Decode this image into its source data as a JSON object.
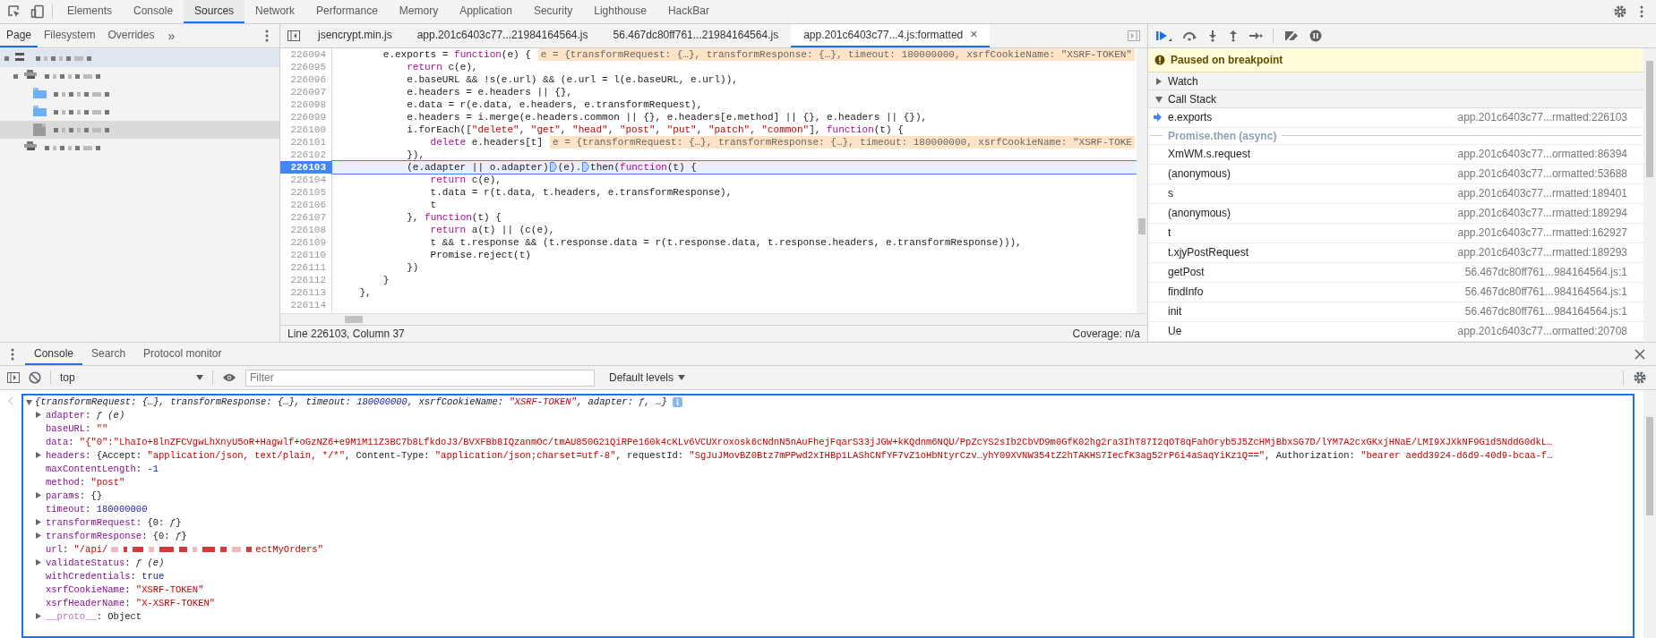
{
  "main_tabs": [
    {
      "label": "Elements",
      "selected": false
    },
    {
      "label": "Console",
      "selected": false
    },
    {
      "label": "Sources",
      "selected": true
    },
    {
      "label": "Network",
      "selected": false
    },
    {
      "label": "Performance",
      "selected": false
    },
    {
      "label": "Memory",
      "selected": false
    },
    {
      "label": "Application",
      "selected": false
    },
    {
      "label": "Security",
      "selected": false
    },
    {
      "label": "Lighthouse",
      "selected": false
    },
    {
      "label": "HackBar",
      "selected": false
    }
  ],
  "navigator": {
    "tabs": [
      {
        "label": "Page",
        "selected": true
      },
      {
        "label": "Filesystem",
        "selected": false
      },
      {
        "label": "Overrides",
        "selected": false
      }
    ],
    "more": "»",
    "tree": [
      {
        "kind": "frame",
        "hovered": true,
        "selected": false,
        "children": [
          {
            "kind": "cloud",
            "hovered": false,
            "selected": false,
            "children": [
              {
                "kind": "folder",
                "hovered": false,
                "selected": false
              },
              {
                "kind": "folder",
                "hovered": false,
                "selected": false
              },
              {
                "kind": "file",
                "hovered": false,
                "selected": true
              }
            ]
          },
          {
            "kind": "cloud",
            "hovered": false,
            "selected": false
          }
        ]
      }
    ]
  },
  "editor": {
    "tabs": [
      {
        "label": "jsencrypt.min.js",
        "selected": false
      },
      {
        "label": "app.201c6403c77...21984164564.js",
        "selected": false
      },
      {
        "label": "56.467dc80ff761...21984164564.js",
        "selected": false
      },
      {
        "label": "app.201c6403c77...4.js:formatted",
        "selected": true
      }
    ],
    "close": "×",
    "lines": [
      {
        "number": "226094",
        "current": false,
        "tokens": [
          {
            "kind": "plain",
            "text": "        e.exports = "
          },
          {
            "kind": "keyword",
            "text": "function"
          },
          {
            "kind": "plain",
            "text": "(e) {"
          },
          {
            "kind": "inline",
            "text": "e = {transformRequest: {…}, transformResponse: {…}, timeout: 180000000, xsrfCookieName: \"XSRF-TOKEN\""
          }
        ]
      },
      {
        "number": "226095",
        "current": false,
        "tokens": [
          {
            "kind": "keyword",
            "text": "            return"
          },
          {
            "kind": "plain",
            "text": " c(e),"
          }
        ]
      },
      {
        "number": "226096",
        "current": false,
        "tokens": [
          {
            "kind": "plain",
            "text": "            e.baseURL && !s(e.url) && (e.url = l(e.baseURL, e.url)),"
          }
        ]
      },
      {
        "number": "226097",
        "current": false,
        "tokens": [
          {
            "kind": "plain",
            "text": "            e.headers = e.headers || {},"
          }
        ]
      },
      {
        "number": "226098",
        "current": false,
        "tokens": [
          {
            "kind": "plain",
            "text": "            e.data = r(e.data, e.headers, e.transformRequest),"
          }
        ]
      },
      {
        "number": "226099",
        "current": false,
        "tokens": [
          {
            "kind": "plain",
            "text": "            e.headers = i.merge(e.headers.common || {}, e.headers[e.method] || {}, e.headers || {}),"
          }
        ]
      },
      {
        "number": "226100",
        "current": false,
        "tokens": [
          {
            "kind": "plain",
            "text": "            i.forEach(["
          },
          {
            "kind": "string",
            "text": "\"delete\""
          },
          {
            "kind": "plain",
            "text": ", "
          },
          {
            "kind": "string",
            "text": "\"get\""
          },
          {
            "kind": "plain",
            "text": ", "
          },
          {
            "kind": "string",
            "text": "\"head\""
          },
          {
            "kind": "plain",
            "text": ", "
          },
          {
            "kind": "string",
            "text": "\"post\""
          },
          {
            "kind": "plain",
            "text": ", "
          },
          {
            "kind": "string",
            "text": "\"put\""
          },
          {
            "kind": "plain",
            "text": ", "
          },
          {
            "kind": "string",
            "text": "\"patch\""
          },
          {
            "kind": "plain",
            "text": ", "
          },
          {
            "kind": "string",
            "text": "\"common\""
          },
          {
            "kind": "plain",
            "text": "], "
          },
          {
            "kind": "keyword",
            "text": "function"
          },
          {
            "kind": "plain",
            "text": "(t) {"
          }
        ]
      },
      {
        "number": "226101",
        "current": false,
        "tokens": [
          {
            "kind": "keyword",
            "text": "                delete"
          },
          {
            "kind": "plain",
            "text": " e.headers[t]"
          },
          {
            "kind": "inline",
            "text": "e = {transformRequest: {…}, transformResponse: {…}, timeout: 180000000, xsrfCookieName: \"XSRF-TOKE"
          }
        ]
      },
      {
        "number": "226102",
        "current": false,
        "tokens": [
          {
            "kind": "plain",
            "text": "            }),"
          }
        ]
      },
      {
        "number": "226103",
        "current": true,
        "tokens": [
          {
            "kind": "plain",
            "text": "            (e.adapter || o.adapter)"
          },
          {
            "kind": "breakpoint"
          },
          {
            "kind": "plain",
            "text": "(e)."
          },
          {
            "kind": "breakpoint"
          },
          {
            "kind": "plain",
            "text": "then("
          },
          {
            "kind": "keyword",
            "text": "function"
          },
          {
            "kind": "plain",
            "text": "(t) {"
          }
        ]
      },
      {
        "number": "226104",
        "current": false,
        "tokens": [
          {
            "kind": "keyword",
            "text": "                return"
          },
          {
            "kind": "plain",
            "text": " c(e),"
          }
        ]
      },
      {
        "number": "226105",
        "current": false,
        "tokens": [
          {
            "kind": "plain",
            "text": "                t.data = r(t.data, t.headers, e.transformResponse),"
          }
        ]
      },
      {
        "number": "226106",
        "current": false,
        "tokens": [
          {
            "kind": "plain",
            "text": "                t"
          }
        ]
      },
      {
        "number": "226107",
        "current": false,
        "tokens": [
          {
            "kind": "plain",
            "text": "            }, "
          },
          {
            "kind": "keyword",
            "text": "function"
          },
          {
            "kind": "plain",
            "text": "(t) {"
          }
        ]
      },
      {
        "number": "226108",
        "current": false,
        "tokens": [
          {
            "kind": "keyword",
            "text": "                return"
          },
          {
            "kind": "plain",
            "text": " a(t) || (c(e),"
          }
        ]
      },
      {
        "number": "226109",
        "current": false,
        "tokens": [
          {
            "kind": "plain",
            "text": "                t && t.response && (t.response.data = r(t.response.data, t.response.headers, e.transformResponse))),"
          }
        ]
      },
      {
        "number": "226110",
        "current": false,
        "tokens": [
          {
            "kind": "plain",
            "text": "                Promise.reject(t)"
          }
        ]
      },
      {
        "number": "226111",
        "current": false,
        "tokens": [
          {
            "kind": "plain",
            "text": "            })"
          }
        ]
      },
      {
        "number": "226112",
        "current": false,
        "tokens": [
          {
            "kind": "plain",
            "text": "        }"
          }
        ]
      },
      {
        "number": "226113",
        "current": false,
        "tokens": [
          {
            "kind": "plain",
            "text": "    },"
          }
        ]
      },
      {
        "number": "226114",
        "current": false
      }
    ],
    "status": "Line 226103, Column 37",
    "coverage": "Coverage: n/a"
  },
  "debugger": {
    "banner": "Paused on breakpoint",
    "sections": [
      {
        "title": "Watch",
        "expanded": false
      },
      {
        "title": "Call Stack",
        "expanded": true
      }
    ],
    "call_stack": [
      {
        "kind": "frame",
        "name": "e.exports",
        "location": "app.201c6403c77...rmatted:226103",
        "current": true
      },
      {
        "kind": "async",
        "name": "Promise.then (async)"
      },
      {
        "kind": "frame",
        "name": "XmWM.s.request",
        "location": "app.201c6403c77...ormatted:86394",
        "current": false
      },
      {
        "kind": "frame",
        "name": "(anonymous)",
        "location": "app.201c6403c77...ormatted:53688",
        "current": false
      },
      {
        "kind": "frame",
        "name": "s",
        "location": "app.201c6403c77...rmatted:189401",
        "current": false
      },
      {
        "kind": "frame",
        "name": "(anonymous)",
        "location": "app.201c6403c77...rmatted:189294",
        "current": false
      },
      {
        "kind": "frame",
        "name": "t",
        "location": "app.201c6403c77...rmatted:162927",
        "current": false
      },
      {
        "kind": "frame",
        "name": "t.xjyPostRequest",
        "location": "app.201c6403c77...rmatted:189293",
        "current": false
      },
      {
        "kind": "frame",
        "name": "getPost",
        "location": "56.467dc80ff761...984164564.js:1",
        "current": false
      },
      {
        "kind": "frame",
        "name": "findInfo",
        "location": "56.467dc80ff761...984164564.js:1",
        "current": false
      },
      {
        "kind": "frame",
        "name": "init",
        "location": "56.467dc80ff761...984164564.js:1",
        "current": false
      },
      {
        "kind": "frame",
        "name": "Ue",
        "location": "app.201c6403c77...ormatted:20708",
        "current": false
      }
    ]
  },
  "drawer": {
    "tabs": [
      {
        "label": "Console",
        "selected": true
      },
      {
        "label": "Search",
        "selected": false
      },
      {
        "label": "Protocol monitor",
        "selected": false
      }
    ],
    "context": "top",
    "filter": {
      "placeholder": "Filter"
    },
    "levels": "Default levels",
    "summary": [
      {
        "kind": "plain",
        "text": "{transformRequest: {…}, transformResponse: {…}, timeout: "
      },
      {
        "kind": "number",
        "text": "180000000"
      },
      {
        "kind": "plain",
        "text": ", xsrfCookieName: "
      },
      {
        "kind": "string",
        "text": "\"XSRF-TOKEN\""
      },
      {
        "kind": "plain",
        "text": ", adapter: ƒ, …}"
      }
    ],
    "properties": [
      {
        "expandable": true,
        "segments": [
          {
            "kind": "key",
            "text": "adapter"
          },
          {
            "kind": "plain",
            "text": ": "
          },
          {
            "kind": "function",
            "text": "ƒ (e)"
          }
        ]
      },
      {
        "expandable": false,
        "segments": [
          {
            "kind": "key",
            "text": "baseURL"
          },
          {
            "kind": "plain",
            "text": ": "
          },
          {
            "kind": "string",
            "text": "\"\""
          }
        ]
      },
      {
        "expandable": false,
        "segments": [
          {
            "kind": "key",
            "text": "data"
          },
          {
            "kind": "plain",
            "text": ": "
          },
          {
            "kind": "string",
            "text": "\"{\"0\":\"LhaIo+8lnZFCVgwLhXnyU5oR+Hagwlf+oGzNZ6+e9M1M11Z3BC7b8LfkdoJ3/BVXFBb8IQzanmOc/tmAU850G21QiRPe160k4cKLv6VCUXroxosk6cNdnN5nAuFhejFqarS33jJGW+kKQdnm6NQU/PpZcYS2sIb2CbVD9m0GfK02hg2ra3IhT87I2qOT8qFahOryb5J5ZcHMjBbxSG7D/lYM7A2cxGKxjHNaE/LMI9XJXkNF9G1d5NddG0dkL…"
          }
        ]
      },
      {
        "expandable": true,
        "segments": [
          {
            "kind": "key",
            "text": "headers"
          },
          {
            "kind": "plain",
            "text": ": {Accept: "
          },
          {
            "kind": "string",
            "text": "\"application/json, text/plain, */*\""
          },
          {
            "kind": "plain",
            "text": ", Content-Type: "
          },
          {
            "kind": "string",
            "text": "\"application/json;charset=utf-8\""
          },
          {
            "kind": "plain",
            "text": ", requestId: "
          },
          {
            "kind": "string",
            "text": "\"SgJuJMovBZ0Btz7mPPwd2xIHBp1LAShCNfYF7vZ1oHbNtyrCzv…yhY09XVNW354tZ2hTAKHS7IecfK3ag52rP6i4aSaqYiKz1Q==\""
          },
          {
            "kind": "plain",
            "text": ", Authorization: "
          },
          {
            "kind": "string",
            "text": "\"bearer aedd3924-d6d9-40d9-bcaa-f…"
          }
        ]
      },
      {
        "expandable": false,
        "segments": [
          {
            "kind": "key",
            "text": "maxContentLength"
          },
          {
            "kind": "plain",
            "text": ": "
          },
          {
            "kind": "number",
            "text": "-1"
          }
        ]
      },
      {
        "expandable": false,
        "segments": [
          {
            "kind": "key",
            "text": "method"
          },
          {
            "kind": "plain",
            "text": ": "
          },
          {
            "kind": "string",
            "text": "\"post\""
          }
        ]
      },
      {
        "expandable": true,
        "segments": [
          {
            "kind": "key",
            "text": "params"
          },
          {
            "kind": "plain",
            "text": ": {}"
          }
        ]
      },
      {
        "expandable": false,
        "segments": [
          {
            "kind": "key",
            "text": "timeout"
          },
          {
            "kind": "plain",
            "text": ": "
          },
          {
            "kind": "number",
            "text": "180000000"
          }
        ]
      },
      {
        "expandable": true,
        "segments": [
          {
            "kind": "key",
            "text": "transformRequest"
          },
          {
            "kind": "plain",
            "text": ": {0: "
          },
          {
            "kind": "function",
            "text": "ƒ"
          },
          {
            "kind": "plain",
            "text": "}"
          }
        ]
      },
      {
        "expandable": true,
        "segments": [
          {
            "kind": "key",
            "text": "transformResponse"
          },
          {
            "kind": "plain",
            "text": ": {0: "
          },
          {
            "kind": "function",
            "text": "ƒ"
          },
          {
            "kind": "plain",
            "text": "}"
          }
        ]
      },
      {
        "expandable": false,
        "segments": [
          {
            "kind": "key",
            "text": "url"
          },
          {
            "kind": "plain",
            "text": ": "
          },
          {
            "kind": "string",
            "text": "\"/api/"
          },
          {
            "kind": "redacted"
          },
          {
            "kind": "string",
            "text": "ectMyOrders\""
          }
        ]
      },
      {
        "expandable": true,
        "segments": [
          {
            "kind": "key",
            "text": "validateStatus"
          },
          {
            "kind": "plain",
            "text": ": "
          },
          {
            "kind": "function",
            "text": "ƒ (e)"
          }
        ]
      },
      {
        "expandable": false,
        "segments": [
          {
            "kind": "key",
            "text": "withCredentials"
          },
          {
            "kind": "plain",
            "text": ": "
          },
          {
            "kind": "number",
            "text": "true"
          }
        ]
      },
      {
        "expandable": false,
        "segments": [
          {
            "kind": "key",
            "text": "xsrfCookieName"
          },
          {
            "kind": "plain",
            "text": ": "
          },
          {
            "kind": "string",
            "text": "\"XSRF-TOKEN\""
          }
        ]
      },
      {
        "expandable": false,
        "segments": [
          {
            "kind": "key",
            "text": "xsrfHeaderName"
          },
          {
            "kind": "plain",
            "text": ": "
          },
          {
            "kind": "string",
            "text": "\"X-XSRF-TOKEN\""
          }
        ]
      },
      {
        "expandable": true,
        "segments": [
          {
            "kind": "dimkey",
            "text": "__proto__"
          },
          {
            "kind": "plain",
            "text": ": Object"
          }
        ]
      }
    ]
  }
}
